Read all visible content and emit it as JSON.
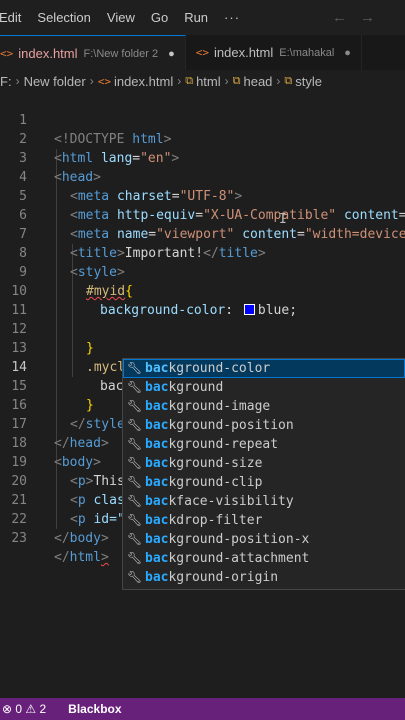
{
  "menubar": {
    "items": [
      "Edit",
      "Selection",
      "View",
      "Go",
      "Run",
      "···"
    ],
    "back_icon": "arrow-left-icon",
    "forward_icon": "arrow-right-icon"
  },
  "tabs": [
    {
      "name": "index.html",
      "path": "F:\\New folder 2",
      "state": "●"
    },
    {
      "name": "index.html",
      "path": "E:\\mahakal",
      "state": "●"
    }
  ],
  "breadcrumb": {
    "items": [
      "F:",
      "New folder",
      "index.html",
      "html",
      "head",
      "style"
    ]
  },
  "editor": {
    "line_numbers": [
      "1",
      "2",
      "3",
      "4",
      "5",
      "6",
      "7",
      "8",
      "9",
      "10",
      "11",
      "12",
      "13",
      "14",
      "15",
      "16",
      "17",
      "18",
      "19",
      "20",
      "21",
      "22",
      "23"
    ],
    "current_line": "14",
    "lines": {
      "l1": {
        "a": "<!DOCTYPE",
        "b": " html",
        "c": ">"
      },
      "l2": {
        "t": "html",
        "attr": "lang",
        "val": "\"en\""
      },
      "l3": {
        "t": "head"
      },
      "l4": {
        "t": "meta",
        "attr": "charset",
        "val": "\"UTF-8\""
      },
      "l5": {
        "t": "meta",
        "attr": "http-equiv",
        "val": "\"X-UA-Compatible\"",
        "attr2": "content",
        "val2": "\""
      },
      "l6": {
        "t": "meta",
        "attr": "name",
        "val": "\"viewport\"",
        "attr2": "content",
        "val2": "\"width=device-"
      },
      "l7": {
        "t": "title",
        "text": "Important!",
        "t2": "title"
      },
      "l8": {
        "t": "style"
      },
      "l9": {
        "sel": "#myid",
        "brace": "{"
      },
      "l10": {
        "prop": "background-color",
        "colon": ":",
        "val": "blue",
        "semi": ";"
      },
      "l12": {
        "brace": "}"
      },
      "l13": {
        "sel": ".myclass",
        "brace": "{"
      },
      "l14": {
        "typed": "bac"
      },
      "l15": {
        "brace": "}"
      },
      "l16": {
        "t": "style"
      },
      "l17": {
        "t": "head"
      },
      "l18": {
        "t": "body"
      },
      "l19": {
        "t": "p",
        "text": "This"
      },
      "l20": {
        "t": "p",
        "attr": "clas"
      },
      "l21": {
        "t": "p",
        "attr": "id=\""
      },
      "l22": {
        "t": "body"
      },
      "l23": {
        "t": "html"
      }
    },
    "blue_swatch_color": "#0000ff"
  },
  "suggestions": {
    "match": "bac",
    "items": [
      {
        "rest": "kground-color"
      },
      {
        "rest": "kground"
      },
      {
        "rest": "kground-image"
      },
      {
        "rest": "kground-position"
      },
      {
        "rest": "kground-repeat"
      },
      {
        "rest": "kground-size"
      },
      {
        "rest": "kground-clip"
      },
      {
        "rest": "kface-visibility"
      },
      {
        "rest": "kdrop-filter"
      },
      {
        "rest": "kground-position-x"
      },
      {
        "rest": "kground-attachment"
      },
      {
        "rest": "kground-origin"
      }
    ],
    "icon": "wrench-icon"
  },
  "statusbar": {
    "errors": "⊗ 0",
    "warnings": "⚠ 2",
    "extension": "Blackbox",
    "color": "#68217a"
  }
}
